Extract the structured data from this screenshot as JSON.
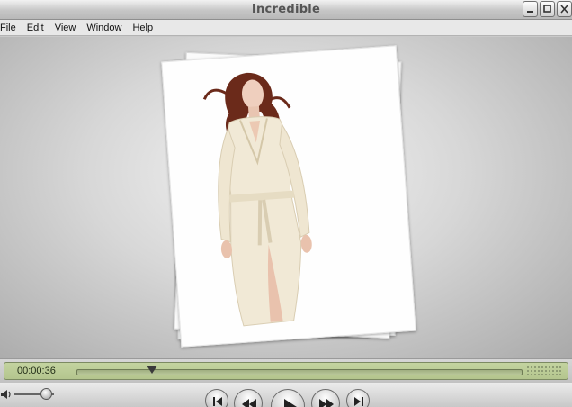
{
  "window": {
    "title": "Incredible",
    "buttons": [
      {
        "name": "minimize-button",
        "icon": "minimize-icon"
      },
      {
        "name": "maximize-button",
        "icon": "maximize-icon"
      },
      {
        "name": "close-button",
        "icon": "close-icon"
      }
    ]
  },
  "menu": [
    "File",
    "Edit",
    "View",
    "Window",
    "Help"
  ],
  "viewer": {
    "content": "stack of fashion photographs (woman in white robe)"
  },
  "player": {
    "timecode": "00:00:36",
    "progress": 0.17,
    "volume": 0.8,
    "transport": [
      "skip-back-icon",
      "rewind-icon",
      "play-icon",
      "fast-forward-icon",
      "skip-forward-icon"
    ]
  },
  "colors": {
    "lcd": "#b9c995",
    "chrome": "#c9c9c9"
  }
}
